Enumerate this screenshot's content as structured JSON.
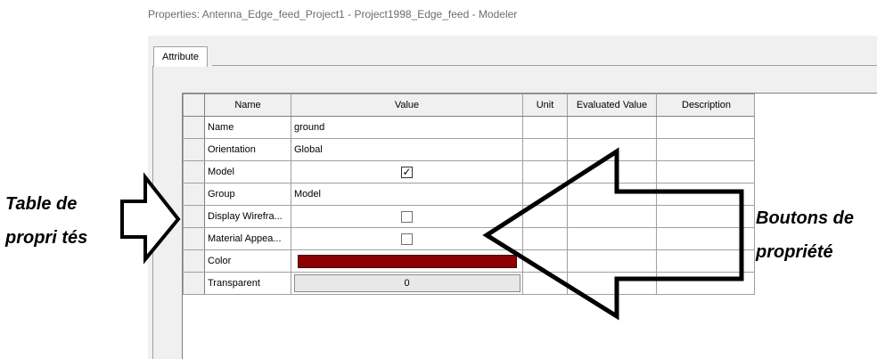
{
  "window": {
    "title": "Properties: Antenna_Edge_feed_Project1 - Project1998_Edge_feed - Modeler"
  },
  "tabs": [
    {
      "label": "Attribute",
      "active": true
    }
  ],
  "table": {
    "columns": [
      "Name",
      "Value",
      "Unit",
      "Evaluated Value",
      "Description"
    ],
    "rows": [
      {
        "name": "Name",
        "value": "ground",
        "kind": "text"
      },
      {
        "name": "Orientation",
        "value": "Global",
        "kind": "text"
      },
      {
        "name": "Model",
        "value": "✓",
        "kind": "checkbox",
        "checked": true
      },
      {
        "name": "Group",
        "value": "Model",
        "kind": "text"
      },
      {
        "name": "Display Wirefra...",
        "value": "",
        "kind": "checkbox",
        "checked": false
      },
      {
        "name": "Material Appea...",
        "value": "",
        "kind": "checkbox",
        "checked": false
      },
      {
        "name": "Color",
        "value": "",
        "kind": "color",
        "color": "#8b0000"
      },
      {
        "name": "Transparent",
        "value": "0",
        "kind": "button"
      }
    ]
  },
  "annotations": {
    "left_line1": "Table de",
    "left_line2": "propri tés",
    "right_line1": "Boutons de",
    "right_line2": "propriété"
  }
}
